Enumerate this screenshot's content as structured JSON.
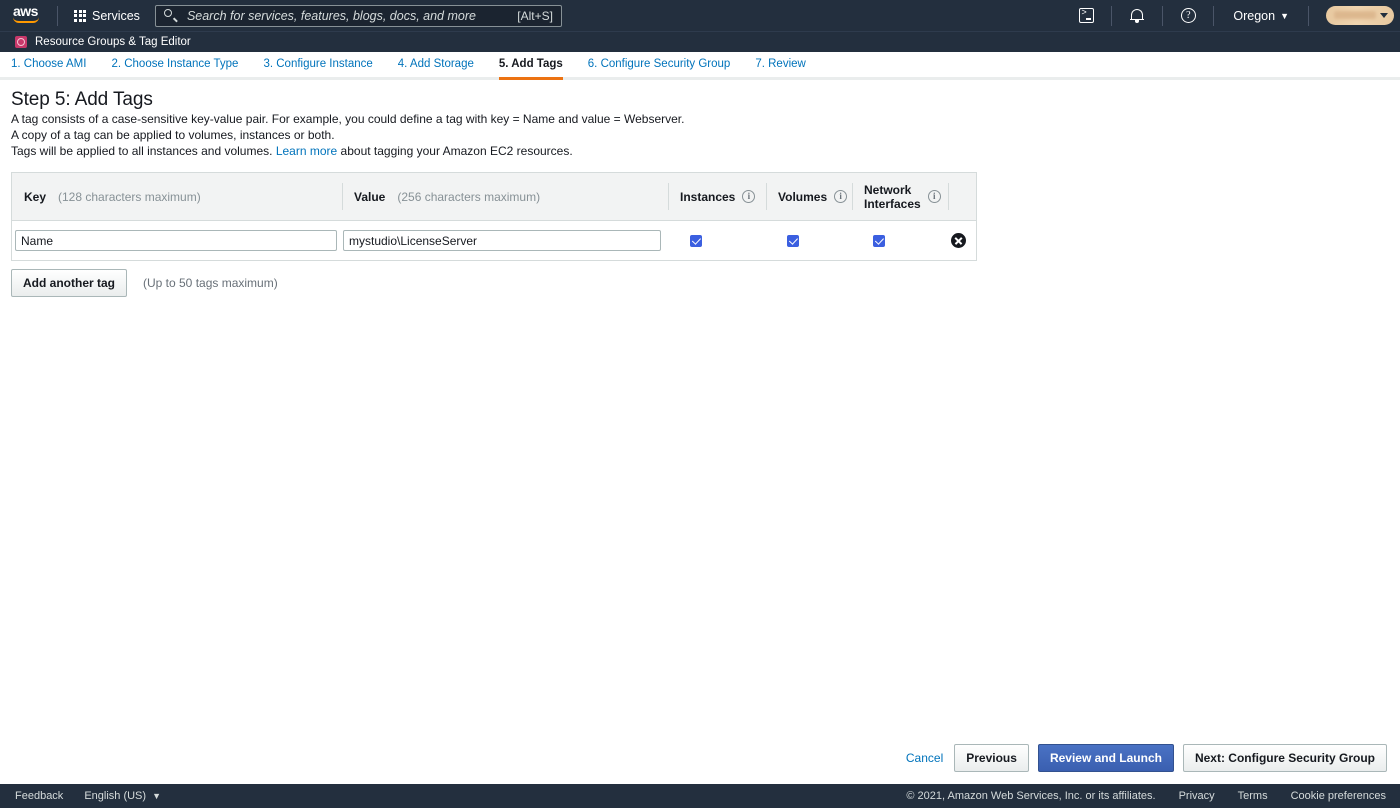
{
  "topnav": {
    "logo_text": "aws",
    "services_label": "Services",
    "search_placeholder": "Search for services, features, blogs, docs, and more",
    "search_value": "",
    "search_shortcut": "[Alt+S]",
    "icons": {
      "cloudshell": "cloudshell-icon",
      "notifications": "bell-icon",
      "help": "help-icon"
    },
    "region": "Oregon",
    "account_label": ""
  },
  "subbar": {
    "label": "Resource Groups & Tag Editor",
    "icon": "resource-groups-icon",
    "icon_color": "#c7386a"
  },
  "steps": [
    {
      "label": "1. Choose AMI",
      "active": false
    },
    {
      "label": "2. Choose Instance Type",
      "active": false
    },
    {
      "label": "3. Configure Instance",
      "active": false
    },
    {
      "label": "4. Add Storage",
      "active": false
    },
    {
      "label": "5. Add Tags",
      "active": true
    },
    {
      "label": "6. Configure Security Group",
      "active": false
    },
    {
      "label": "7. Review",
      "active": false
    }
  ],
  "heading": "Step 5: Add Tags",
  "description": {
    "line1": "A tag consists of a case-sensitive key-value pair. For example, you could define a tag with key = Name and value = Webserver.",
    "line2": "A copy of a tag can be applied to volumes, instances or both.",
    "line3_before": "Tags will be applied to all instances and volumes.",
    "line3_link": "Learn more",
    "line3_after": "about tagging your Amazon EC2 resources."
  },
  "table": {
    "headers": {
      "key": "Key",
      "key_hint": "(128 characters maximum)",
      "value": "Value",
      "value_hint": "(256 characters maximum)",
      "instances": "Instances",
      "volumes": "Volumes",
      "network_interfaces_line1": "Network",
      "network_interfaces_line2": "Interfaces"
    },
    "rows": [
      {
        "key": "Name",
        "value": "mystudio\\LicenseServer",
        "instances_checked": true,
        "volumes_checked": true,
        "network_interfaces_checked": true
      }
    ]
  },
  "add_tag": {
    "button_label": "Add another tag",
    "hint": "(Up to 50 tags maximum)"
  },
  "actions": {
    "cancel": "Cancel",
    "previous": "Previous",
    "review_and_launch": "Review and Launch",
    "next": "Next: Configure Security Group",
    "primary_color": "#3a5fb0"
  },
  "footer": {
    "feedback": "Feedback",
    "language": "English (US)",
    "copyright": "© 2021, Amazon Web Services, Inc. or its affiliates.",
    "privacy": "Privacy",
    "terms": "Terms",
    "cookie_preferences": "Cookie preferences"
  }
}
